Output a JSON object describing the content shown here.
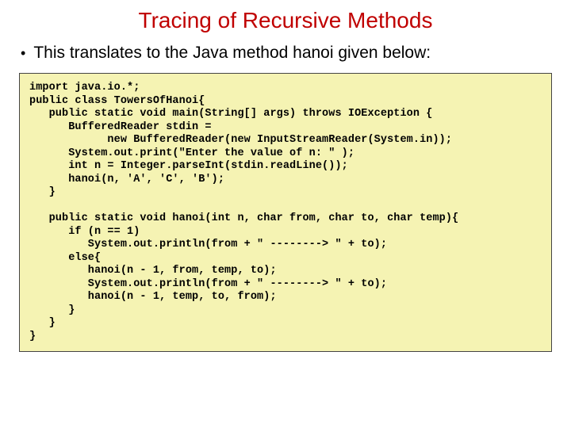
{
  "title": "Tracing of Recursive Methods",
  "bullet": "This translates to the Java method hanoi given below:",
  "code": "import java.io.*;\npublic class TowersOfHanoi{\n   public static void main(String[] args) throws IOException {\n      BufferedReader stdin =\n            new BufferedReader(new InputStreamReader(System.in));\n      System.out.print(\"Enter the value of n: \" );\n      int n = Integer.parseInt(stdin.readLine());\n      hanoi(n, 'A', 'C', 'B');\n   }\n\n   public static void hanoi(int n, char from, char to, char temp){\n      if (n == 1)\n         System.out.println(from + \" --------> \" + to);\n      else{\n         hanoi(n - 1, from, temp, to);\n         System.out.println(from + \" --------> \" + to);\n         hanoi(n - 1, temp, to, from);\n      }\n   }\n}"
}
